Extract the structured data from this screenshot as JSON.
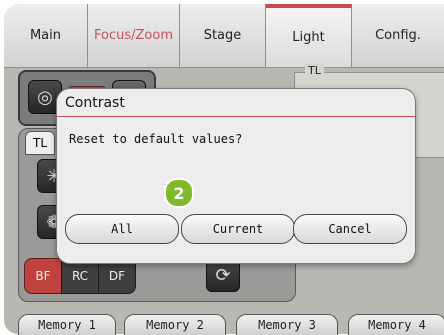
{
  "tabs": [
    {
      "label": "Main"
    },
    {
      "label": "Focus/Zoom"
    },
    {
      "label": "Stage"
    },
    {
      "label": "Light"
    },
    {
      "label": "Config."
    }
  ],
  "active_tab": "Light",
  "colors": {
    "accent": "#c84a4f",
    "focus_text": "#c9525a",
    "badge": "#7fba2a"
  },
  "left_panel": {
    "group_tab_label": "TL",
    "illumination_modes": [
      "BF",
      "RC",
      "DF"
    ],
    "icons": [
      "diaphragm-icon",
      "lamp-icon",
      "aperture-icon",
      "refresh-icon"
    ]
  },
  "tl_box": {
    "label": "TL"
  },
  "memories": [
    "Memory 1",
    "Memory 2",
    "Memory 3",
    "Memory 4"
  ],
  "dialog": {
    "title": "Contrast",
    "message": "Reset to default values?",
    "buttons": {
      "all": "All",
      "current": "Current",
      "cancel": "Cancel"
    },
    "badge": "2"
  }
}
